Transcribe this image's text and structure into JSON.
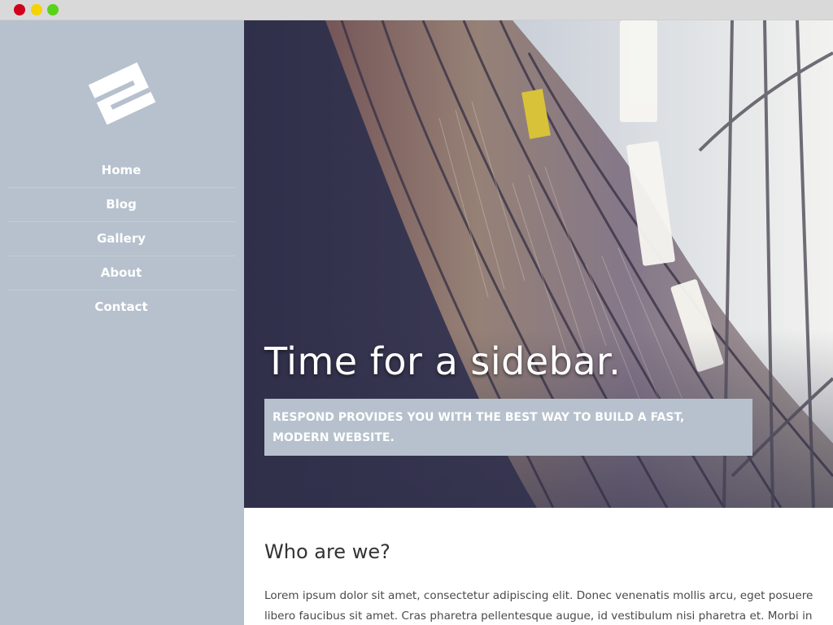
{
  "window": {
    "controls": [
      "close",
      "minimize",
      "zoom"
    ]
  },
  "sidebar": {
    "logo_icon": "respond-logo-icon",
    "items": [
      {
        "label": "Home"
      },
      {
        "label": "Blog"
      },
      {
        "label": "Gallery"
      },
      {
        "label": "About"
      },
      {
        "label": "Contact"
      }
    ]
  },
  "hero": {
    "title": "Time for a sidebar.",
    "subtitle": "RESPOND PROVIDES YOU WITH THE BEST WAY TO BUILD A FAST, MODERN WEBSITE."
  },
  "content": {
    "heading": "Who are we?",
    "paragraph": "Lorem ipsum dolor sit amet, consectetur adipiscing elit. Donec venenatis mollis arcu, eget posuere libero faucibus sit amet. Cras pharetra pellentesque augue, id vestibulum nisi pharetra et. Morbi in dapibus leo."
  },
  "colors": {
    "sidebar_bg": "#b6c1cd",
    "chrome_bg": "#d9d9d9",
    "close": "#d0021b",
    "minimize": "#f5d300",
    "zoom": "#5ad21a"
  }
}
